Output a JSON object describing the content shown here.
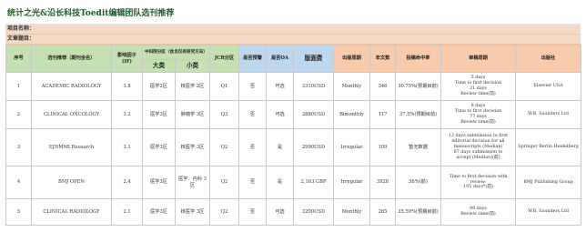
{
  "title": "统计之光&沿长科技Toedit编辑团队选刊推荐",
  "project_name_label": "项目名称：",
  "article_title_label": "文章题目：",
  "headers": {
    "no": "序号",
    "journal": "选刊推荐（期刊全名）",
    "if": "影响因子\n(IF)",
    "cas_group": "中科院分区（含且仅有研究方向）",
    "major": "大类",
    "minor": "小类",
    "jcr": "JCR分区",
    "warning": "是否预警",
    "oa": "是否OA",
    "apc": "版面费",
    "freq": "出版周期",
    "volume": "年文数",
    "accept": "投稿命中率",
    "review": "审稿周期",
    "publisher": "出版社"
  },
  "rows": [
    {
      "no": "1",
      "journal": "ACADEMIC RADIOLOGY",
      "if": "3.8",
      "major": "医学2区",
      "minor": "核医学 2区",
      "jcr": "Q1",
      "warning": "否",
      "oa": "可选",
      "apc": "3310USD",
      "freq": "Monthly",
      "volume": "346",
      "accept": "30.75%(预期目前)",
      "review": "5 days\nTime to first decision\n21 days\nReview time(前)",
      "publisher": "Elsevier USA"
    },
    {
      "no": "2",
      "journal": "CLINICAL ONCOLOGY",
      "if": "3.2",
      "major": "医学3区",
      "minor": "肿瘤学 3区",
      "jcr": "Q3",
      "warning": "否",
      "oa": "可选",
      "apc": "2880USD",
      "freq": "Bimonthly",
      "volume": "117",
      "accept": "37.5%(预期目前)",
      "review": "8 days\nTime to first decision\n77 days\nReview time(前)",
      "publisher": "W.B. Saunders Ltd"
    },
    {
      "no": "3",
      "journal": "EJNMMI Research",
      "if": "3.1",
      "major": "医学3区",
      "minor": "核医学 3区",
      "jcr": "Q2",
      "warning": "否",
      "oa": "是",
      "apc": "2990USD",
      "freq": "Irregular",
      "volume": "109",
      "accept": "暂无数据",
      "review": "12 days submission to first\neditorial decision for all\nmanuscripts (Median)\n87 days submission to\naccept (Median)(前)",
      "publisher": "Springer Berlin Heidelberg"
    },
    {
      "no": "4",
      "journal": "BMJ OPEN",
      "if": "2.4",
      "major": "医学3区",
      "minor": "医学：内科 3区",
      "jcr": "Q2",
      "warning": "否",
      "oa": "是",
      "apc": "2,163 GBP",
      "freq": "Irregular",
      "volume": "3928",
      "accept": "36%(前)",
      "review": "Time to first decision with\nreview:\n105 days*(前)",
      "publisher": "BMJ Publishing Group"
    },
    {
      "no": "5",
      "journal": "CLINICAL RADIOLOGY",
      "if": "2.1",
      "major": "医学3区",
      "minor": "核医学 3区",
      "jcr": "Q2",
      "warning": "否",
      "oa": "可选",
      "apc": "3200USD",
      "freq": "Monthly",
      "volume": "265",
      "accept": "35.59%(预期目前)",
      "review": "80 days\nReview time(前)",
      "publisher": "W.B. Saunders Ltd"
    }
  ],
  "colors": {
    "header_green": "#c5e0b3",
    "header_blue": "#bdd7ee",
    "header_orange": "#f8cbad",
    "meta_band": "#f3d9c6",
    "title_text": "#1f5c2e"
  }
}
